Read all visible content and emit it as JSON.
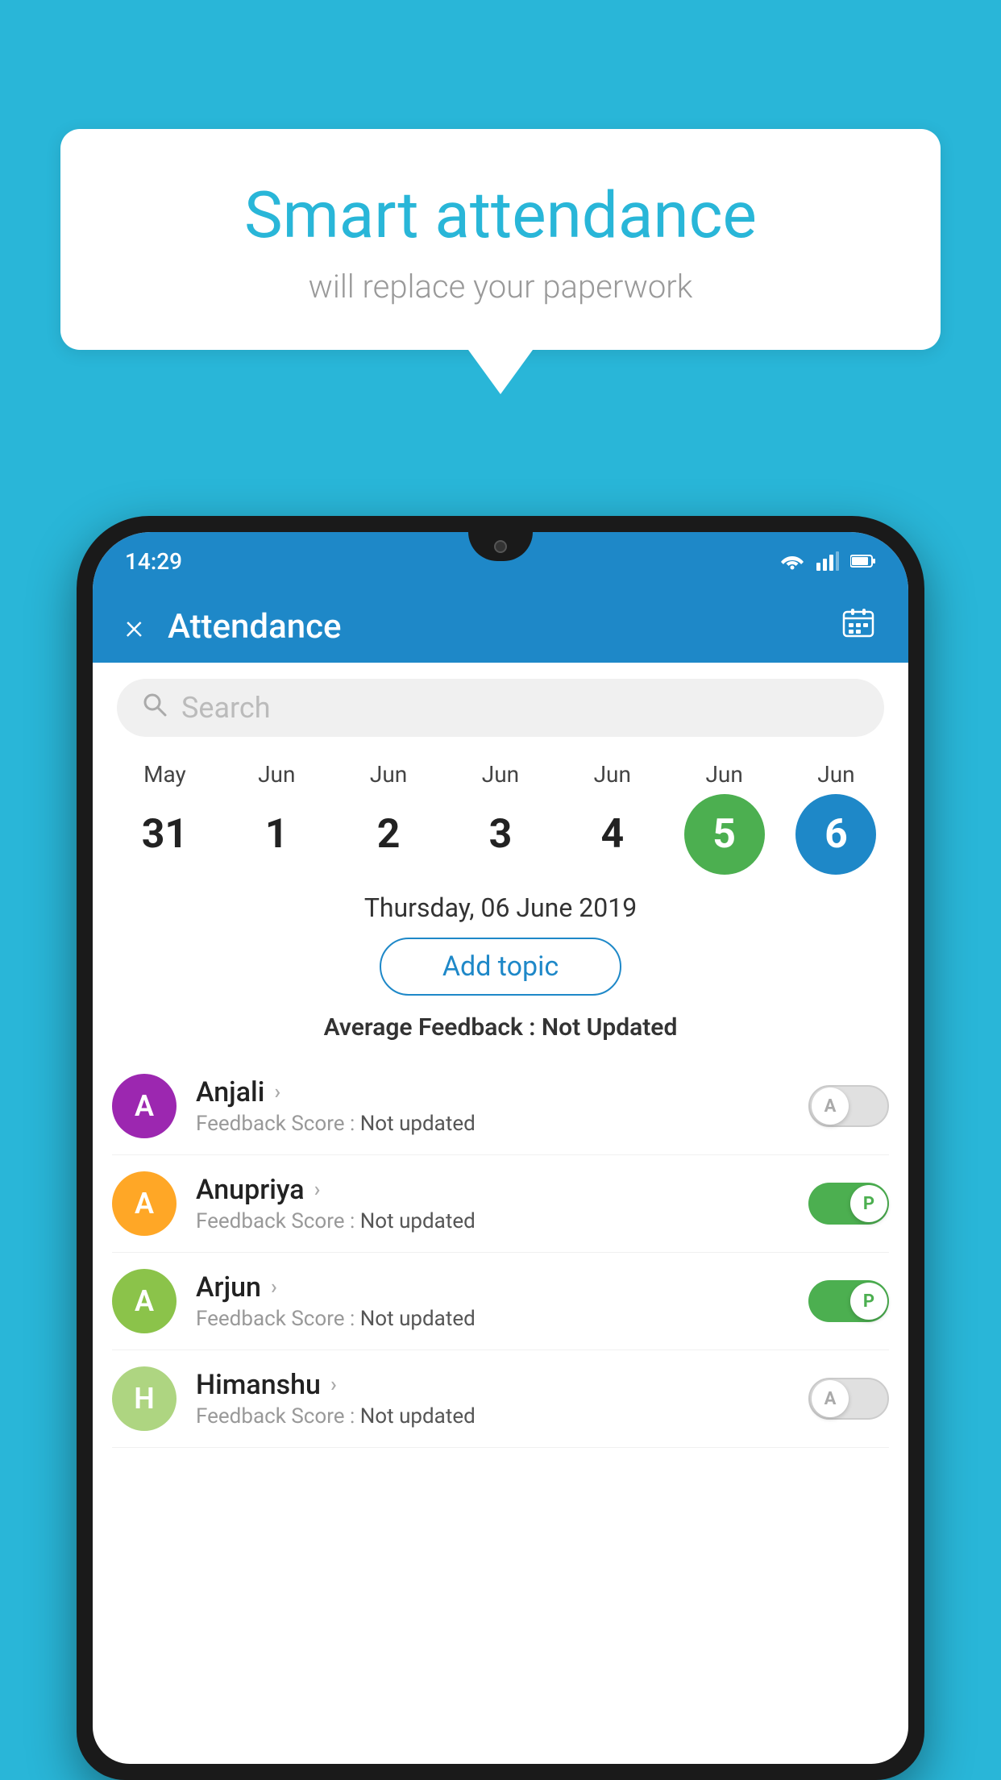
{
  "background_color": "#29b6d8",
  "speech_bubble": {
    "title": "Smart attendance",
    "subtitle": "will replace your paperwork"
  },
  "status_bar": {
    "time": "14:29"
  },
  "app_header": {
    "title": "Attendance",
    "close_label": "×",
    "calendar_icon": "📅"
  },
  "search": {
    "placeholder": "Search"
  },
  "dates": [
    {
      "month": "May",
      "day": "31",
      "style": "normal"
    },
    {
      "month": "Jun",
      "day": "1",
      "style": "normal"
    },
    {
      "month": "Jun",
      "day": "2",
      "style": "normal"
    },
    {
      "month": "Jun",
      "day": "3",
      "style": "normal"
    },
    {
      "month": "Jun",
      "day": "4",
      "style": "normal"
    },
    {
      "month": "Jun",
      "day": "5",
      "style": "green"
    },
    {
      "month": "Jun",
      "day": "6",
      "style": "blue"
    }
  ],
  "selected_date": "Thursday, 06 June 2019",
  "add_topic_label": "Add topic",
  "average_feedback": {
    "label": "Average Feedback : ",
    "value": "Not Updated"
  },
  "students": [
    {
      "name": "Anjali",
      "avatar_letter": "A",
      "avatar_color": "#9c27b0",
      "feedback": "Feedback Score : ",
      "feedback_value": "Not updated",
      "toggle": "off",
      "toggle_letter": "A"
    },
    {
      "name": "Anupriya",
      "avatar_letter": "A",
      "avatar_color": "#ffa726",
      "feedback": "Feedback Score : ",
      "feedback_value": "Not updated",
      "toggle": "on",
      "toggle_letter": "P"
    },
    {
      "name": "Arjun",
      "avatar_letter": "A",
      "avatar_color": "#8bc34a",
      "feedback": "Feedback Score : ",
      "feedback_value": "Not updated",
      "toggle": "on",
      "toggle_letter": "P"
    },
    {
      "name": "Himanshu",
      "avatar_letter": "H",
      "avatar_color": "#aed581",
      "feedback": "Feedback Score : ",
      "feedback_value": "Not updated",
      "toggle": "off",
      "toggle_letter": "A"
    }
  ]
}
